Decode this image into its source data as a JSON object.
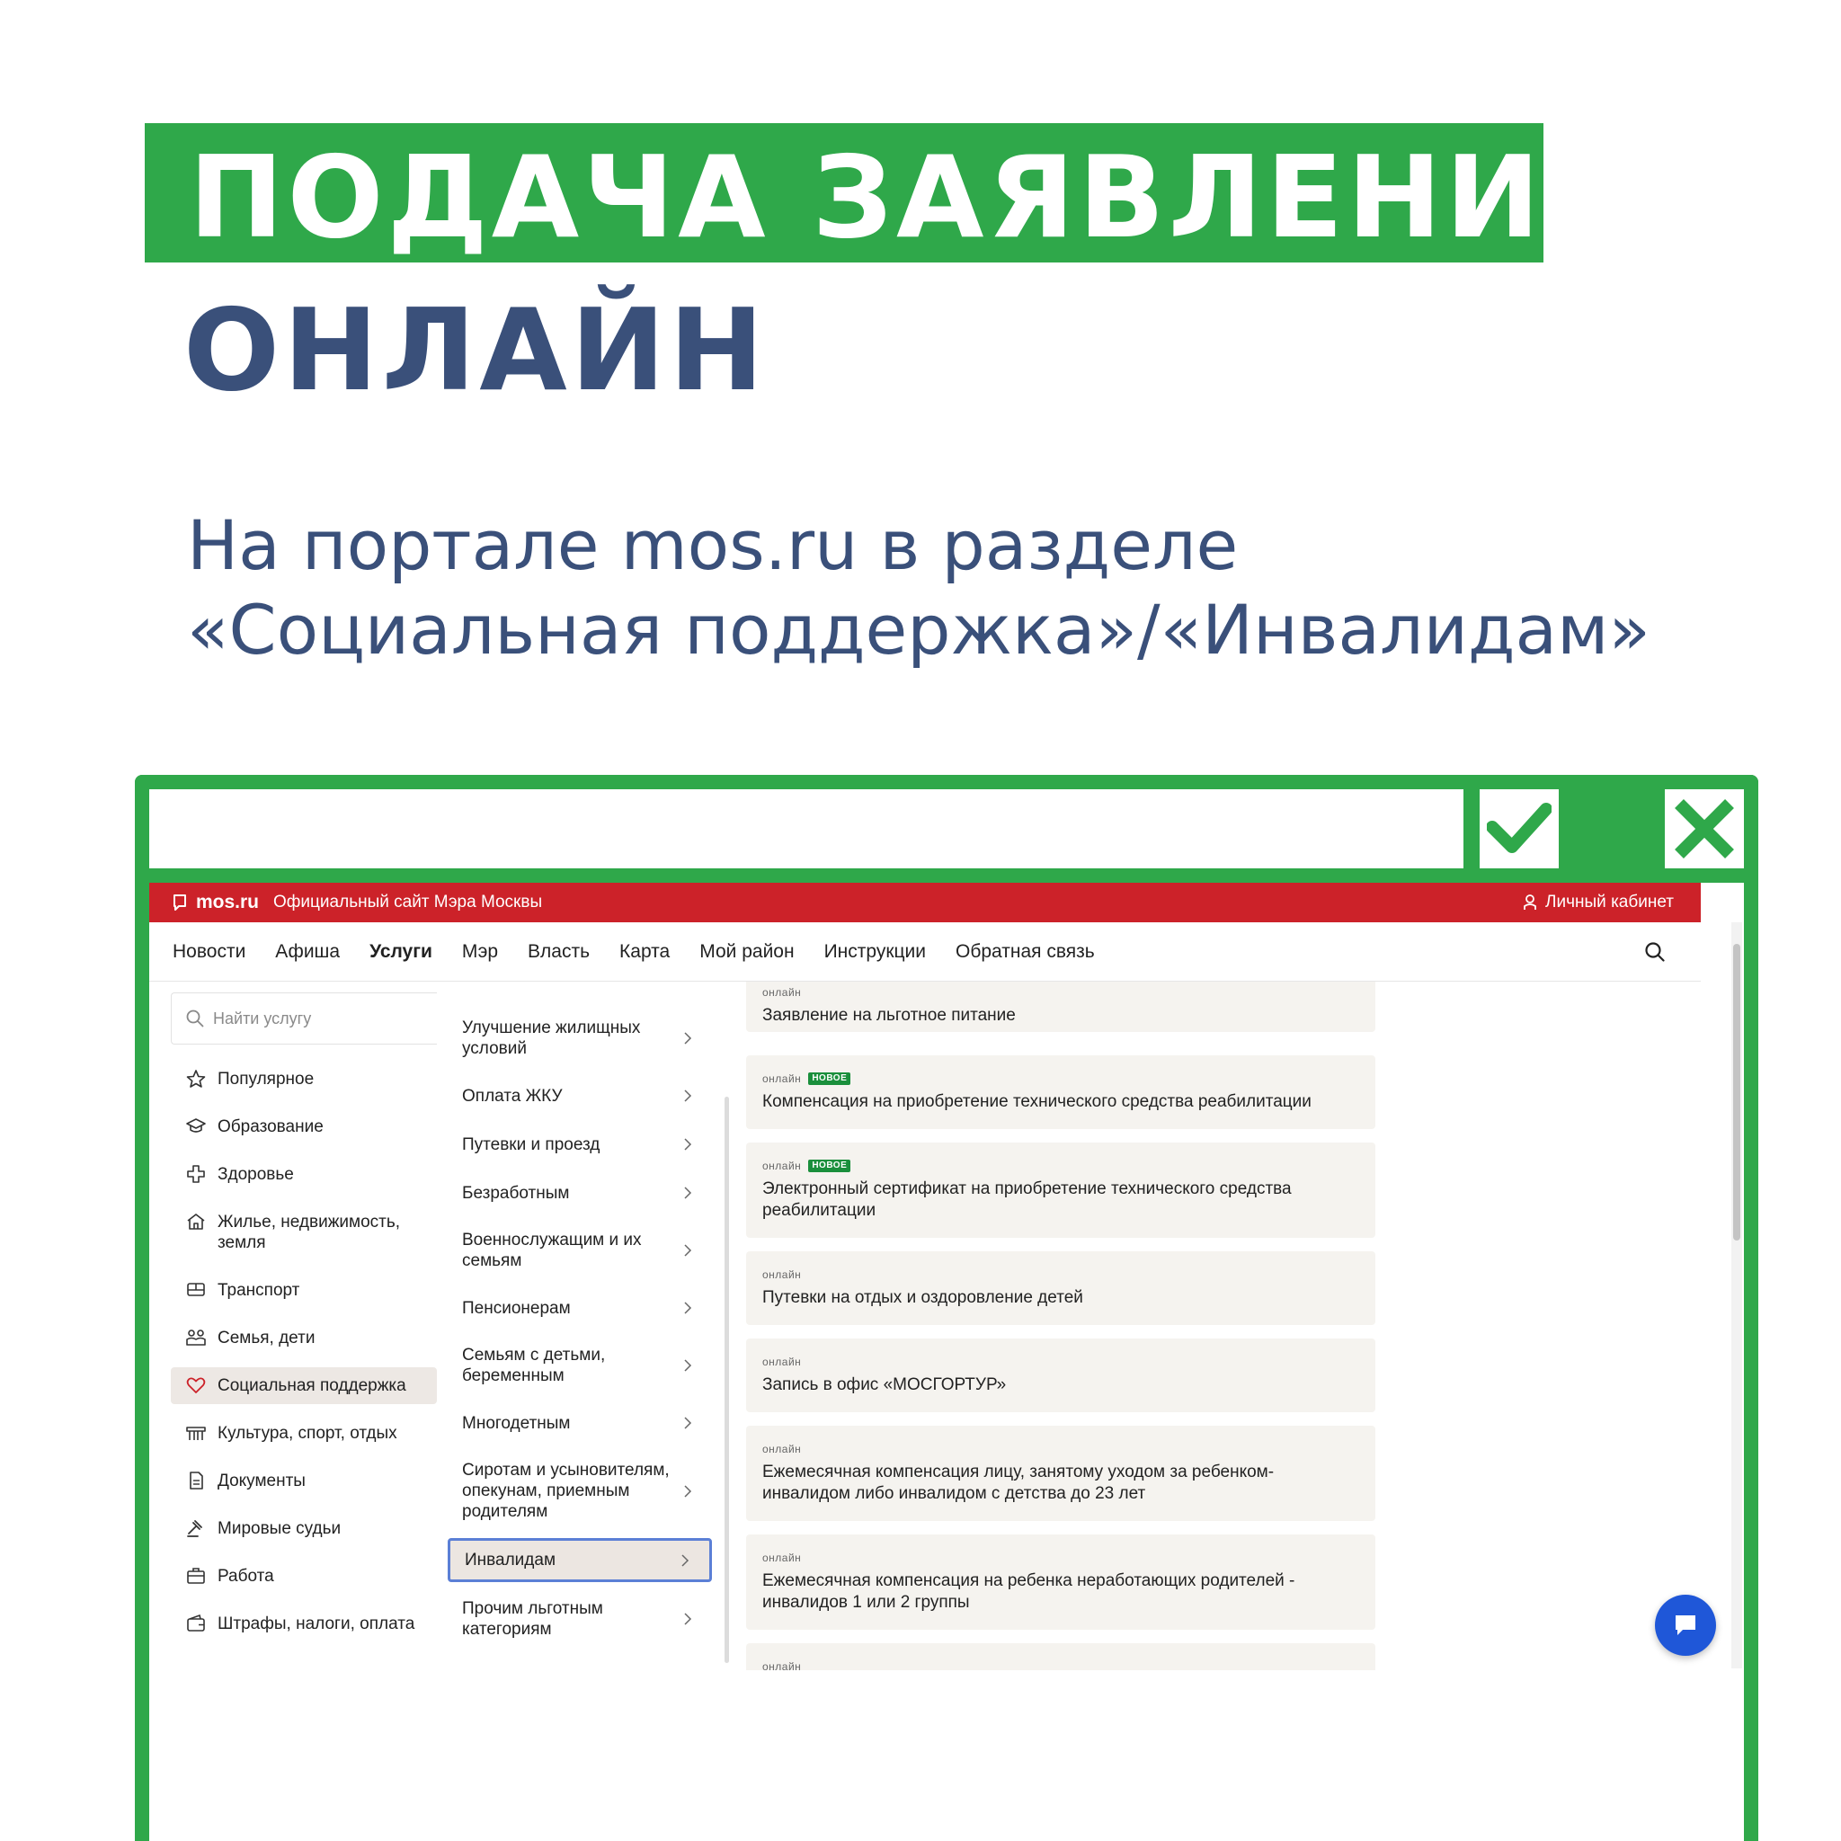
{
  "header": {
    "title_line1": "ПОДАЧА ЗАЯВЛЕНИЯ",
    "title_line2": "ОНЛАЙН",
    "subtitle_line1": "На портале mos.ru в разделе",
    "subtitle_line2": "«Социальная поддержка»/«Инвалидам»"
  },
  "colors": {
    "brand_green": "#2fa84a",
    "title_blue": "#3a507a",
    "site_red": "#cc2229",
    "chat_blue": "#1f57d8",
    "highlight_border": "#5b7fd6"
  },
  "frame": {
    "check_icon": "check-icon",
    "close_icon": "close-icon"
  },
  "site": {
    "logo": "mos.ru",
    "slogan": "Официальный сайт Мэра Москвы",
    "cabinet": "Личный кабинет",
    "nav": [
      "Новости",
      "Афиша",
      "Услуги",
      "Мэр",
      "Власть",
      "Карта",
      "Мой район",
      "Инструкции",
      "Обратная связь"
    ],
    "nav_active": "Услуги",
    "search_placeholder": "Найти услугу",
    "categories": [
      {
        "label": "Популярное",
        "icon": "star-icon"
      },
      {
        "label": "Образование",
        "icon": "graduation-cap-icon"
      },
      {
        "label": "Здоровье",
        "icon": "medical-cross-icon"
      },
      {
        "label": "Жилье, недвижимость, земля",
        "icon": "house-icon"
      },
      {
        "label": "Транспорт",
        "icon": "bus-icon"
      },
      {
        "label": "Семья, дети",
        "icon": "family-icon"
      },
      {
        "label": "Социальная поддержка",
        "icon": "heart-icon"
      },
      {
        "label": "Культура, спорт, отдых",
        "icon": "theater-icon"
      },
      {
        "label": "Документы",
        "icon": "document-icon"
      },
      {
        "label": "Мировые судьи",
        "icon": "gavel-icon"
      },
      {
        "label": "Работа",
        "icon": "briefcase-icon"
      },
      {
        "label": "Штрафы, налоги, оплата",
        "icon": "wallet-icon"
      }
    ],
    "active_category": "Социальная поддержка",
    "submenu": [
      "Улучшение жилищных условий",
      "Оплата ЖКУ",
      "Путевки и проезд",
      "Безработным",
      "Военнослужащим и их семьям",
      "Пенсионерам",
      "Семьям с детьми, беременным",
      "Многодетным",
      "Сиротам и усыновителям, опекунам, приемным родителям",
      "Инвалидам",
      "Прочим льготным категориям"
    ],
    "active_submenu": "Инвалидам",
    "services": [
      {
        "tag": "онлайн",
        "new": "",
        "title": "Заявление на льготное питание"
      },
      {
        "tag": "онлайн",
        "new": "НОВОЕ",
        "title": "Компенсация на приобретение технического средства реабилитации"
      },
      {
        "tag": "онлайн",
        "new": "НОВОЕ",
        "title": "Электронный сертификат на приобретение технического средства реабилитации"
      },
      {
        "tag": "онлайн",
        "new": "",
        "title": "Путевки на отдых и оздоровление детей"
      },
      {
        "tag": "онлайн",
        "new": "",
        "title": "Запись в офис «МОСГОРТУР»"
      },
      {
        "tag": "онлайн",
        "new": "",
        "title": "Ежемесячная компенсация лицу, занятому уходом за ребенком-инвалидом либо инвалидом с детства до 23 лет"
      },
      {
        "tag": "онлайн",
        "new": "",
        "title": "Ежемесячная компенсация на ребенка неработающих родителей - инвалидов 1 или 2 группы"
      },
      {
        "tag": "онлайн",
        "new": "",
        "title": ""
      }
    ]
  }
}
